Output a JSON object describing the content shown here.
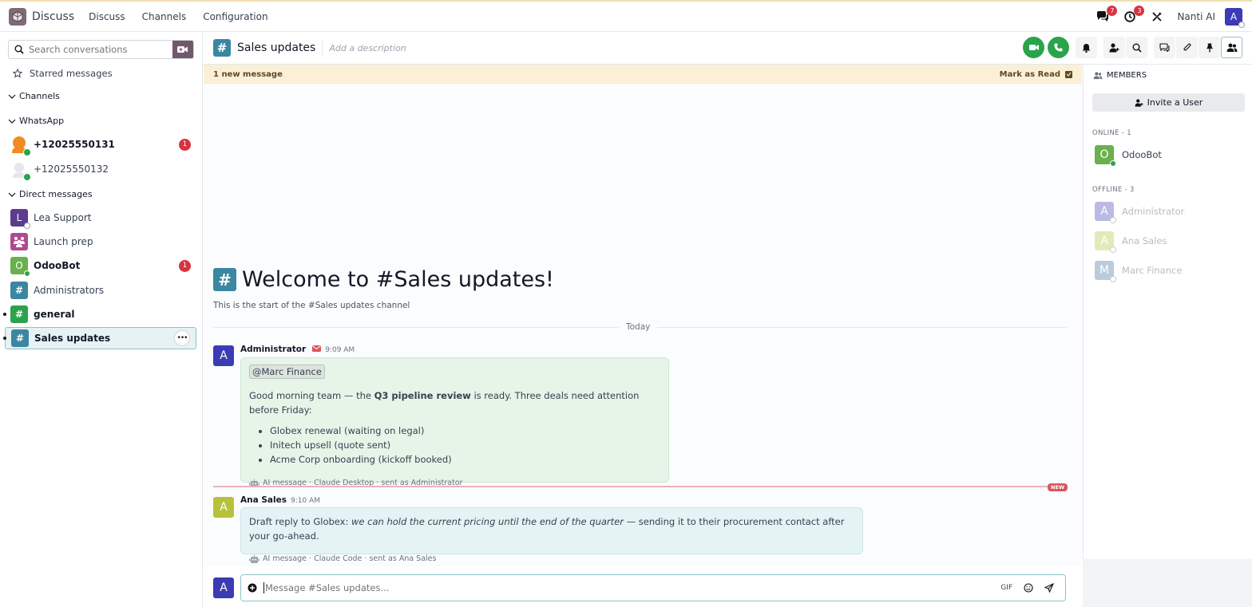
{
  "topbar": {
    "app_name": "Discuss",
    "nav": [
      "Discuss",
      "Channels",
      "Configuration"
    ],
    "messages_badge": "7",
    "activity_badge": "3",
    "user_name": "Nanti AI",
    "user_initial": "A"
  },
  "sidebar": {
    "search_placeholder": "Search conversations",
    "starred": "Starred messages",
    "sections": {
      "channels": "Channels",
      "whatsapp": "WhatsApp",
      "direct": "Direct messages"
    },
    "whatsapp": [
      {
        "label": "+12025550131",
        "badge": "1"
      },
      {
        "label": "+12025550132"
      }
    ],
    "direct": [
      {
        "label": "Lea Support",
        "initial": "L"
      },
      {
        "label": "Launch prep"
      },
      {
        "label": "OdooBot",
        "initial": "O",
        "badge": "1"
      },
      {
        "label": "Administrators"
      },
      {
        "label": "general"
      },
      {
        "label": "Sales updates"
      }
    ]
  },
  "header": {
    "title": "Sales updates",
    "description_placeholder": "Add a description"
  },
  "banner": {
    "text": "1 new message",
    "mark_read": "Mark as Read"
  },
  "thread": {
    "welcome_title": "Welcome to #Sales updates!",
    "welcome_sub": "This is the start of the #Sales updates channel",
    "day": "Today",
    "messages": [
      {
        "author": "Administrator",
        "initial": "A",
        "time": "9:09 AM",
        "mention": "@Marc Finance",
        "text_before": "Good morning team — the ",
        "text_bold": "Q3 pipeline review",
        "text_after": " is ready. Three deals need attention before Friday:",
        "bullets": [
          "Globex renewal (waiting on legal)",
          "Initech upsell (quote sent)",
          "Acme Corp onboarding (kickoff booked)"
        ],
        "meta": "AI message · Claude Desktop · sent as Administrator"
      },
      {
        "author": "Ana Sales",
        "initial": "A",
        "time": "9:10 AM",
        "text_before": "Draft reply to Globex: ",
        "text_italic": "we can hold the current pricing until the end of the quarter",
        "text_after": " — sending it to their procurement contact after your go-ahead.",
        "meta": "AI message · Claude Code · sent as Ana Sales"
      }
    ],
    "new_tag": "NEW"
  },
  "composer": {
    "avatar_initial": "A",
    "placeholder": "Message #Sales updates...",
    "gif_label": "GIF"
  },
  "members": {
    "title": "MEMBERS",
    "invite": "Invite a User",
    "online_label": "ONLINE - 1",
    "offline_label": "OFFLINE - 3",
    "online": [
      {
        "name": "OdooBot",
        "initial": "O"
      }
    ],
    "offline": [
      {
        "name": "Administrator",
        "initial": "A"
      },
      {
        "name": "Ana Sales",
        "initial": "A"
      },
      {
        "name": "Marc Finance",
        "initial": "M"
      }
    ]
  },
  "colors": {
    "brand": "#71596b",
    "teal": "#3b86a0",
    "call_green": "#29a44b",
    "badge_red": "#d9333f"
  }
}
